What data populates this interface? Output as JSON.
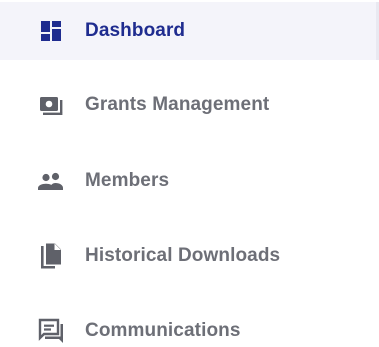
{
  "sidebar": {
    "active_color": "#1f2c8f",
    "inactive_color": "#6d6f77",
    "items": [
      {
        "label": "Dashboard",
        "icon": "dashboard-icon",
        "active": true
      },
      {
        "label": "Grants Management",
        "icon": "grants-icon",
        "active": false
      },
      {
        "label": "Members",
        "icon": "members-icon",
        "active": false
      },
      {
        "label": "Historical Downloads",
        "icon": "documents-icon",
        "active": false
      },
      {
        "label": "Communications",
        "icon": "communications-icon",
        "active": false
      }
    ]
  }
}
